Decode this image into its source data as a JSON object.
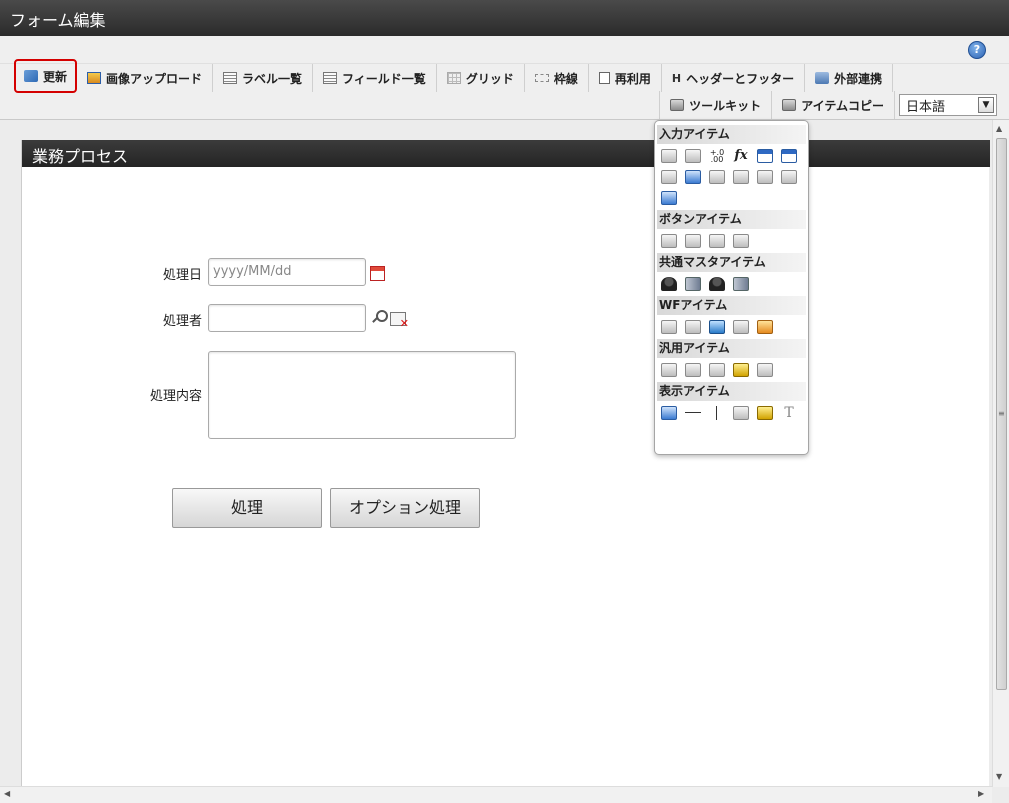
{
  "window": {
    "title": "フォーム編集"
  },
  "help": {
    "icon": "help-icon",
    "glyph": "?"
  },
  "toolbar": {
    "row1": [
      {
        "name": "update",
        "label": "更新",
        "icon": "update-icon"
      },
      {
        "name": "image-upload",
        "label": "画像アップロード",
        "icon": "image-upload-icon"
      },
      {
        "name": "label-list",
        "label": "ラベル一覧",
        "icon": "label-list-icon"
      },
      {
        "name": "field-list",
        "label": "フィールド一覧",
        "icon": "field-list-icon"
      },
      {
        "name": "grid",
        "label": "グリッド",
        "icon": "grid-icon"
      },
      {
        "name": "frame",
        "label": "枠線",
        "icon": "frame-icon"
      },
      {
        "name": "reuse",
        "label": "再利用",
        "icon": "reuse-icon"
      },
      {
        "name": "header-footer",
        "label": "ヘッダーとフッター",
        "icon": "header-icon"
      },
      {
        "name": "external-link",
        "label": "外部連携",
        "icon": "external-link-icon"
      }
    ],
    "row2": [
      {
        "name": "toolkit",
        "label": "ツールキット",
        "icon": "toolkit-icon"
      },
      {
        "name": "item-copy",
        "label": "アイテムコピー",
        "icon": "item-copy-icon"
      }
    ],
    "header_glyph": "H",
    "language": {
      "value": "日本語",
      "arrow": "▼"
    }
  },
  "form": {
    "header": "業務プロセス",
    "fields": {
      "date_label": "処理日",
      "date_placeholder": "yyyy/MM/dd",
      "user_label": "処理者",
      "user_value": "",
      "content_label": "処理内容",
      "content_value": ""
    },
    "buttons": {
      "process": "処理",
      "option_process": "オプション処理"
    }
  },
  "toolkit_panel": {
    "sections": [
      {
        "title": "入力アイテム"
      },
      {
        "title": "ボタンアイテム"
      },
      {
        "title": "共通マスタアイテム"
      },
      {
        "title": "WFアイテム"
      },
      {
        "title": "汎用アイテム"
      },
      {
        "title": "表示アイテム"
      }
    ],
    "fx_glyph": "fx",
    "num_glyph": "+.0 .00",
    "text_glyph": "T"
  },
  "scroll": {
    "up": "▲",
    "down": "▼",
    "left": "◀",
    "right": "▶",
    "grip": "≡"
  },
  "colors": {
    "highlight": "#d40000",
    "header_bg": "#2b2b2b",
    "accent_blue": "#2c62b3"
  }
}
